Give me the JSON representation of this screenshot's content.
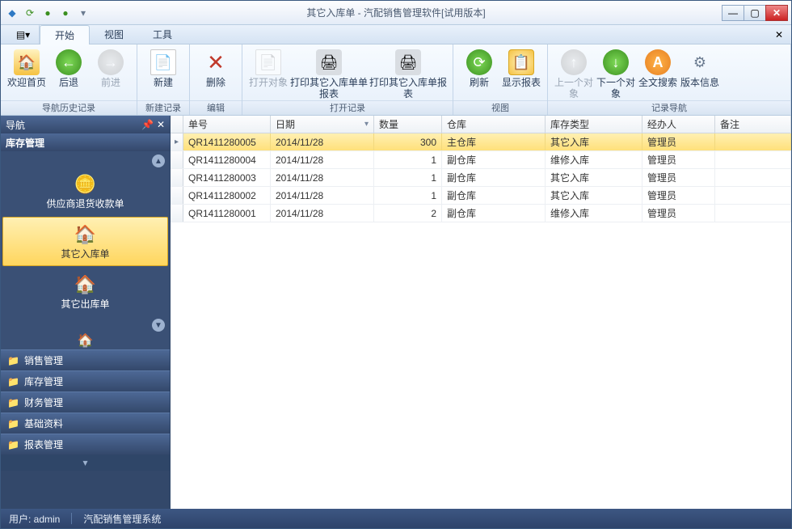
{
  "window": {
    "title": "其它入库单 - 汽配销售管理软件[试用版本]"
  },
  "menutabs": {
    "start": "开始",
    "view": "视图",
    "tools": "工具"
  },
  "ribbon": {
    "groups": {
      "navhist": "导航历史记录",
      "newrec": "新建记录",
      "edit": "编辑",
      "openrec": "打开记录",
      "viewg": "视图",
      "recnav": "记录导航"
    },
    "welcome": "欢迎首页",
    "back": "后退",
    "forward": "前进",
    "newrec": "新建",
    "delete": "删除",
    "openobj": "打开对象",
    "print_single": "打印其它入库单单报表",
    "print_table": "打印其它入库单报表",
    "refresh": "刷新",
    "showreport": "显示报表",
    "prevobj": "上一个对象",
    "nextobj": "下一个对象",
    "fulltext": "全文搜索",
    "version": "版本信息"
  },
  "nav": {
    "title": "导航",
    "category": "库存管理",
    "items": {
      "supplier_return": "供应商退货收款单",
      "other_in": "其它入库单",
      "other_out": "其它出库单"
    },
    "cats": {
      "sales": "销售管理",
      "stock": "库存管理",
      "finance": "财务管理",
      "base": "基础资料",
      "report": "报表管理"
    }
  },
  "grid": {
    "cols": {
      "id": "单号",
      "date": "日期",
      "qty": "数量",
      "wh": "仓库",
      "type": "库存类型",
      "op": "经办人",
      "note": "备注"
    },
    "rows": [
      {
        "id": "QR1411280005",
        "date": "2014/11/28",
        "qty": "300",
        "wh": "主仓库",
        "type": "其它入库",
        "op": "管理员",
        "note": ""
      },
      {
        "id": "QR1411280004",
        "date": "2014/11/28",
        "qty": "1",
        "wh": "副仓库",
        "type": "维修入库",
        "op": "管理员",
        "note": ""
      },
      {
        "id": "QR1411280003",
        "date": "2014/11/28",
        "qty": "1",
        "wh": "副仓库",
        "type": "其它入库",
        "op": "管理员",
        "note": ""
      },
      {
        "id": "QR1411280002",
        "date": "2014/11/28",
        "qty": "1",
        "wh": "副仓库",
        "type": "其它入库",
        "op": "管理员",
        "note": ""
      },
      {
        "id": "QR1411280001",
        "date": "2014/11/28",
        "qty": "2",
        "wh": "副仓库",
        "type": "维修入库",
        "op": "管理员",
        "note": ""
      }
    ]
  },
  "status": {
    "user_label": "用户: admin",
    "system": "汽配销售管理系统"
  }
}
